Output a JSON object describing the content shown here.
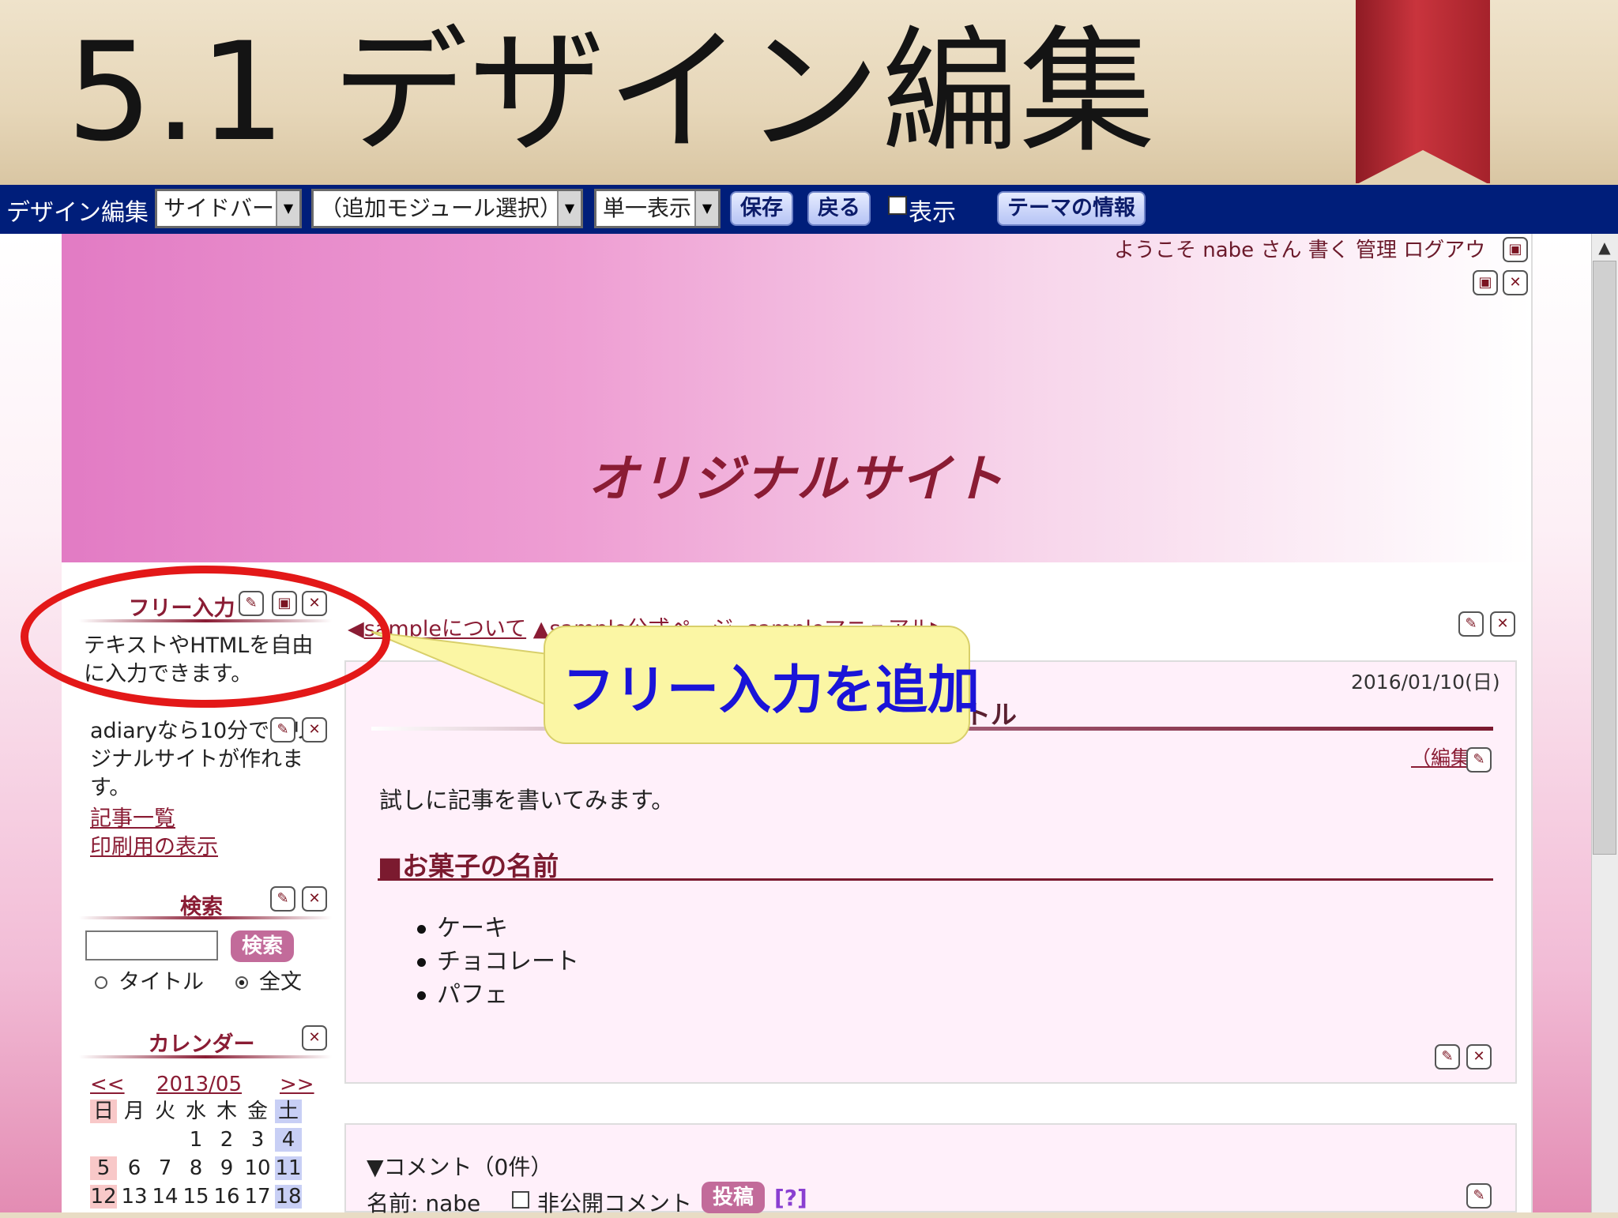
{
  "slide": {
    "title": "5.1 デザイン編集"
  },
  "toolbar": {
    "label": "デザイン編集",
    "select_area": "サイドバー",
    "select_module": "（追加モジュール選択）",
    "select_view": "単一表示",
    "save_label": "保存",
    "back_label": "戻る",
    "show_label": "表示",
    "theme_info_label": "テーマの情報"
  },
  "site": {
    "welcome": "ようこそ nabe さん 書く 管理 ログアウ",
    "banner_title": "オリジナルサイト"
  },
  "sidebar": {
    "free_input_head": "フリー入力",
    "free_input_text": "テキストやHTMLを自由に入力できます。",
    "adiary_text": "adiaryなら10分でオリジナルサイトが作れます。",
    "link_articles": "記事一覧",
    "link_print": "印刷用の表示",
    "search_head": "検索",
    "search_button": "検索",
    "radio_title": "タイトル",
    "radio_full": "全文",
    "calendar_head": "カレンダー",
    "calendar_prev": "<<",
    "calendar_month": "2013/05",
    "calendar_next": ">>",
    "weekdays": [
      "日",
      "月",
      "火",
      "水",
      "木",
      "金",
      "土"
    ],
    "weeks": [
      [
        "",
        "",
        "",
        "1",
        "2",
        "3",
        "4"
      ],
      [
        "5",
        "6",
        "7",
        "8",
        "9",
        "10",
        "11"
      ],
      [
        "12",
        "13",
        "14",
        "15",
        "16",
        "17",
        "18"
      ]
    ]
  },
  "nav": {
    "prev": "sampleについて",
    "up": "sample公式ページ",
    "next": "sampleマニュアル"
  },
  "article": {
    "date": "2016/01/10(日)",
    "title": "記事のタイトル",
    "edit": "（編集）",
    "body": "試しに記事を書いてみます。",
    "heading": "■お菓子の名前",
    "items": [
      "ケーキ",
      "チョコレート",
      "パフェ"
    ]
  },
  "comment": {
    "title": "▼コメント（0件）",
    "name": "名前: nabe",
    "private": "非公開コメント",
    "post": "投稿",
    "help": "[?]"
  },
  "annotation": {
    "callout": "フリー入力を追加"
  },
  "colors": {
    "toolbar_bg": "#001e7a",
    "accent": "#8a1c34",
    "callout_text": "#1a14d8",
    "highlight": "#e31818"
  }
}
